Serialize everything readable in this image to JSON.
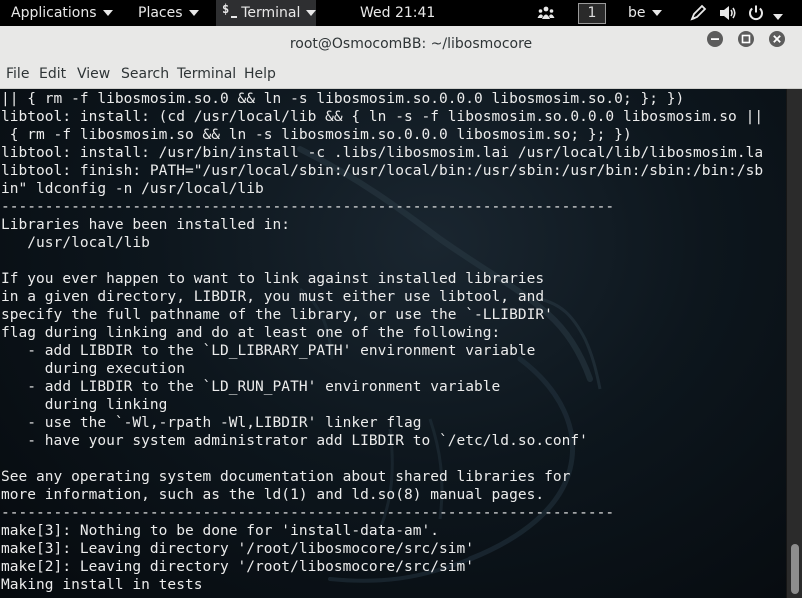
{
  "top_bar": {
    "applications": "Applications",
    "places": "Places",
    "terminal": "Terminal",
    "clock": "Wed 21:41",
    "workspace": "1",
    "language": "be"
  },
  "window": {
    "title": "root@OsmocomBB: ~/libosmocore"
  },
  "menu": [
    "File",
    "Edit",
    "View",
    "Search",
    "Terminal",
    "Help"
  ],
  "terminal_lines": [
    "|| { rm -f libosmosim.so.0 && ln -s libosmosim.so.0.0.0 libosmosim.so.0; }; })",
    "libtool: install: (cd /usr/local/lib && { ln -s -f libosmosim.so.0.0.0 libosmosim.so ||",
    " { rm -f libosmosim.so && ln -s libosmosim.so.0.0.0 libosmosim.so; }; })",
    "libtool: install: /usr/bin/install -c .libs/libosmosim.lai /usr/local/lib/libosmosim.la",
    "libtool: finish: PATH=\"/usr/local/sbin:/usr/local/bin:/usr/sbin:/usr/bin:/sbin:/bin:/sb",
    "in\" ldconfig -n /usr/local/lib",
    "----------------------------------------------------------------------",
    "Libraries have been installed in:",
    "   /usr/local/lib",
    "",
    "If you ever happen to want to link against installed libraries",
    "in a given directory, LIBDIR, you must either use libtool, and",
    "specify the full pathname of the library, or use the `-LLIBDIR'",
    "flag during linking and do at least one of the following:",
    "   - add LIBDIR to the `LD_LIBRARY_PATH' environment variable",
    "     during execution",
    "   - add LIBDIR to the `LD_RUN_PATH' environment variable",
    "     during linking",
    "   - use the `-Wl,-rpath -Wl,LIBDIR' linker flag",
    "   - have your system administrator add LIBDIR to `/etc/ld.so.conf'",
    "",
    "See any operating system documentation about shared libraries for",
    "more information, such as the ld(1) and ld.so(8) manual pages.",
    "----------------------------------------------------------------------",
    "make[3]: Nothing to be done for 'install-data-am'.",
    "make[3]: Leaving directory '/root/libosmocore/src/sim'",
    "make[2]: Leaving directory '/root/libosmocore/src/sim'",
    "Making install in tests"
  ],
  "colors": {
    "panel_bg": "#000000",
    "panel_text": "#e8e8e8",
    "chrome_bg": "#e8e8e7",
    "terminal_text": "#ececec",
    "terminal_bg": "#0d161d"
  },
  "icons": [
    "terminal-icon",
    "network-icon",
    "workspace-icon",
    "pen-icon",
    "volume-icon",
    "power-icon",
    "minimize-icon",
    "maximize-icon",
    "close-icon",
    "kali-dragon-watermark"
  ]
}
